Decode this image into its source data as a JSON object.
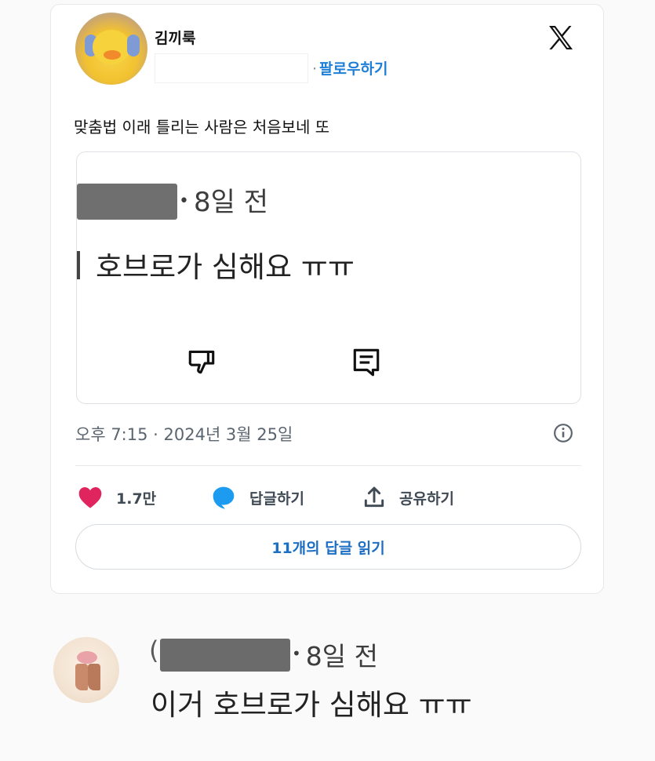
{
  "post": {
    "author_name": "김끼룩",
    "follow_label": "팔로우하기",
    "follow_separator": "·",
    "text": "맞춤법 이래 틀리는 사람은 처음보네 또",
    "platform_icon": "x-logo-icon"
  },
  "embedded_screenshot": {
    "time_ago": "8일 전",
    "comment_text": "호브로가 심해요 ㅠㅠ",
    "icons": [
      "dislike-icon",
      "comment-icon"
    ]
  },
  "meta": {
    "timestamp": "오후 7:15 · 2024년 3월 25일"
  },
  "actions": {
    "like_count": "1.7만",
    "reply_label": "답글하기",
    "share_label": "공유하기",
    "read_replies_label": "11개의 답글 읽기"
  },
  "comment": {
    "open_paren": "(",
    "time_ago": "8일 전",
    "text": "이거 호브로가 심해요 ㅠㅠ"
  },
  "colors": {
    "like": "#e0245e",
    "reply": "#1d9bf0",
    "link": "#1d7fd6",
    "redaction": "#6b6b6b"
  }
}
